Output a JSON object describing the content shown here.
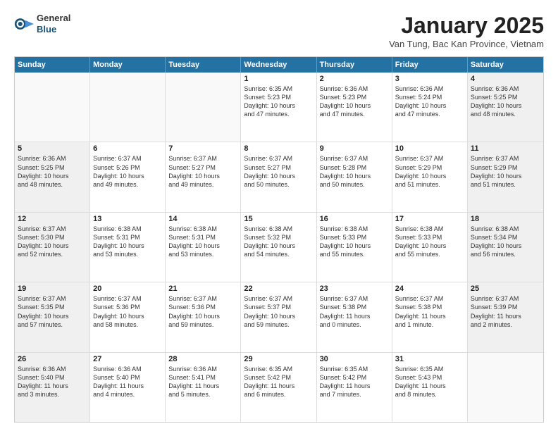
{
  "header": {
    "logo": {
      "general": "General",
      "blue": "Blue"
    },
    "title": "January 2025",
    "subtitle": "Van Tung, Bac Kan Province, Vietnam"
  },
  "days": [
    "Sunday",
    "Monday",
    "Tuesday",
    "Wednesday",
    "Thursday",
    "Friday",
    "Saturday"
  ],
  "weeks": [
    [
      {
        "num": "",
        "lines": [],
        "empty": true
      },
      {
        "num": "",
        "lines": [],
        "empty": true
      },
      {
        "num": "",
        "lines": [],
        "empty": true
      },
      {
        "num": "1",
        "lines": [
          "Sunrise: 6:35 AM",
          "Sunset: 5:23 PM",
          "Daylight: 10 hours",
          "and 47 minutes."
        ]
      },
      {
        "num": "2",
        "lines": [
          "Sunrise: 6:36 AM",
          "Sunset: 5:23 PM",
          "Daylight: 10 hours",
          "and 47 minutes."
        ]
      },
      {
        "num": "3",
        "lines": [
          "Sunrise: 6:36 AM",
          "Sunset: 5:24 PM",
          "Daylight: 10 hours",
          "and 47 minutes."
        ]
      },
      {
        "num": "4",
        "lines": [
          "Sunrise: 6:36 AM",
          "Sunset: 5:25 PM",
          "Daylight: 10 hours",
          "and 48 minutes."
        ]
      }
    ],
    [
      {
        "num": "5",
        "lines": [
          "Sunrise: 6:36 AM",
          "Sunset: 5:25 PM",
          "Daylight: 10 hours",
          "and 48 minutes."
        ]
      },
      {
        "num": "6",
        "lines": [
          "Sunrise: 6:37 AM",
          "Sunset: 5:26 PM",
          "Daylight: 10 hours",
          "and 49 minutes."
        ]
      },
      {
        "num": "7",
        "lines": [
          "Sunrise: 6:37 AM",
          "Sunset: 5:27 PM",
          "Daylight: 10 hours",
          "and 49 minutes."
        ]
      },
      {
        "num": "8",
        "lines": [
          "Sunrise: 6:37 AM",
          "Sunset: 5:27 PM",
          "Daylight: 10 hours",
          "and 50 minutes."
        ]
      },
      {
        "num": "9",
        "lines": [
          "Sunrise: 6:37 AM",
          "Sunset: 5:28 PM",
          "Daylight: 10 hours",
          "and 50 minutes."
        ]
      },
      {
        "num": "10",
        "lines": [
          "Sunrise: 6:37 AM",
          "Sunset: 5:29 PM",
          "Daylight: 10 hours",
          "and 51 minutes."
        ]
      },
      {
        "num": "11",
        "lines": [
          "Sunrise: 6:37 AM",
          "Sunset: 5:29 PM",
          "Daylight: 10 hours",
          "and 51 minutes."
        ]
      }
    ],
    [
      {
        "num": "12",
        "lines": [
          "Sunrise: 6:37 AM",
          "Sunset: 5:30 PM",
          "Daylight: 10 hours",
          "and 52 minutes."
        ]
      },
      {
        "num": "13",
        "lines": [
          "Sunrise: 6:38 AM",
          "Sunset: 5:31 PM",
          "Daylight: 10 hours",
          "and 53 minutes."
        ]
      },
      {
        "num": "14",
        "lines": [
          "Sunrise: 6:38 AM",
          "Sunset: 5:31 PM",
          "Daylight: 10 hours",
          "and 53 minutes."
        ]
      },
      {
        "num": "15",
        "lines": [
          "Sunrise: 6:38 AM",
          "Sunset: 5:32 PM",
          "Daylight: 10 hours",
          "and 54 minutes."
        ]
      },
      {
        "num": "16",
        "lines": [
          "Sunrise: 6:38 AM",
          "Sunset: 5:33 PM",
          "Daylight: 10 hours",
          "and 55 minutes."
        ]
      },
      {
        "num": "17",
        "lines": [
          "Sunrise: 6:38 AM",
          "Sunset: 5:33 PM",
          "Daylight: 10 hours",
          "and 55 minutes."
        ]
      },
      {
        "num": "18",
        "lines": [
          "Sunrise: 6:38 AM",
          "Sunset: 5:34 PM",
          "Daylight: 10 hours",
          "and 56 minutes."
        ]
      }
    ],
    [
      {
        "num": "19",
        "lines": [
          "Sunrise: 6:37 AM",
          "Sunset: 5:35 PM",
          "Daylight: 10 hours",
          "and 57 minutes."
        ]
      },
      {
        "num": "20",
        "lines": [
          "Sunrise: 6:37 AM",
          "Sunset: 5:36 PM",
          "Daylight: 10 hours",
          "and 58 minutes."
        ]
      },
      {
        "num": "21",
        "lines": [
          "Sunrise: 6:37 AM",
          "Sunset: 5:36 PM",
          "Daylight: 10 hours",
          "and 59 minutes."
        ]
      },
      {
        "num": "22",
        "lines": [
          "Sunrise: 6:37 AM",
          "Sunset: 5:37 PM",
          "Daylight: 10 hours",
          "and 59 minutes."
        ]
      },
      {
        "num": "23",
        "lines": [
          "Sunrise: 6:37 AM",
          "Sunset: 5:38 PM",
          "Daylight: 11 hours",
          "and 0 minutes."
        ]
      },
      {
        "num": "24",
        "lines": [
          "Sunrise: 6:37 AM",
          "Sunset: 5:38 PM",
          "Daylight: 11 hours",
          "and 1 minute."
        ]
      },
      {
        "num": "25",
        "lines": [
          "Sunrise: 6:37 AM",
          "Sunset: 5:39 PM",
          "Daylight: 11 hours",
          "and 2 minutes."
        ]
      }
    ],
    [
      {
        "num": "26",
        "lines": [
          "Sunrise: 6:36 AM",
          "Sunset: 5:40 PM",
          "Daylight: 11 hours",
          "and 3 minutes."
        ]
      },
      {
        "num": "27",
        "lines": [
          "Sunrise: 6:36 AM",
          "Sunset: 5:40 PM",
          "Daylight: 11 hours",
          "and 4 minutes."
        ]
      },
      {
        "num": "28",
        "lines": [
          "Sunrise: 6:36 AM",
          "Sunset: 5:41 PM",
          "Daylight: 11 hours",
          "and 5 minutes."
        ]
      },
      {
        "num": "29",
        "lines": [
          "Sunrise: 6:35 AM",
          "Sunset: 5:42 PM",
          "Daylight: 11 hours",
          "and 6 minutes."
        ]
      },
      {
        "num": "30",
        "lines": [
          "Sunrise: 6:35 AM",
          "Sunset: 5:42 PM",
          "Daylight: 11 hours",
          "and 7 minutes."
        ]
      },
      {
        "num": "31",
        "lines": [
          "Sunrise: 6:35 AM",
          "Sunset: 5:43 PM",
          "Daylight: 11 hours",
          "and 8 minutes."
        ]
      },
      {
        "num": "",
        "lines": [],
        "empty": true
      }
    ]
  ]
}
